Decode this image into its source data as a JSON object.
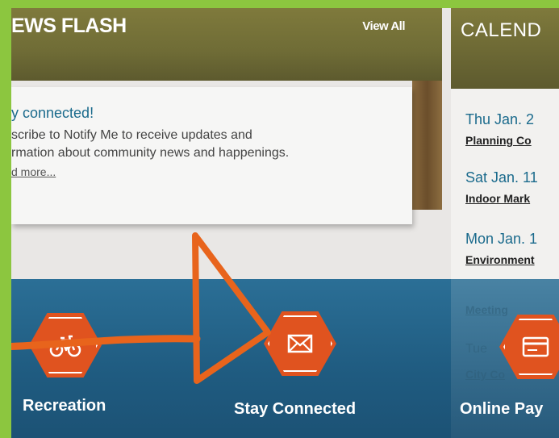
{
  "news": {
    "title": "EWS FLASH",
    "view_all": "View All",
    "card_heading": "y connected!",
    "card_body_line1": "scribe to Notify Me to receive updates and",
    "card_body_line2": "rmation about community news and happenings.",
    "card_link": "d more..."
  },
  "calendar": {
    "title": "CALEND",
    "events": [
      {
        "date": "Thu Jan. 2",
        "name": "Planning Co"
      },
      {
        "date": "Sat Jan. 11",
        "name": "Indoor Mark"
      },
      {
        "date": "Mon Jan. 1",
        "name": "Environment"
      }
    ],
    "faded_1": "Meeting",
    "faded_2": "Tue",
    "faded_3": "City Co"
  },
  "quicklinks": [
    {
      "label": "Recreation",
      "icon": "bicycle-icon"
    },
    {
      "label": "Stay Connected",
      "icon": "envelope-icon"
    },
    {
      "label": "Online Pay",
      "icon": "credit-card-icon"
    }
  ],
  "colors": {
    "border": "#8cc63f",
    "accent": "#e0531f",
    "band": "#1f5b80",
    "link": "#1a6a8c"
  }
}
